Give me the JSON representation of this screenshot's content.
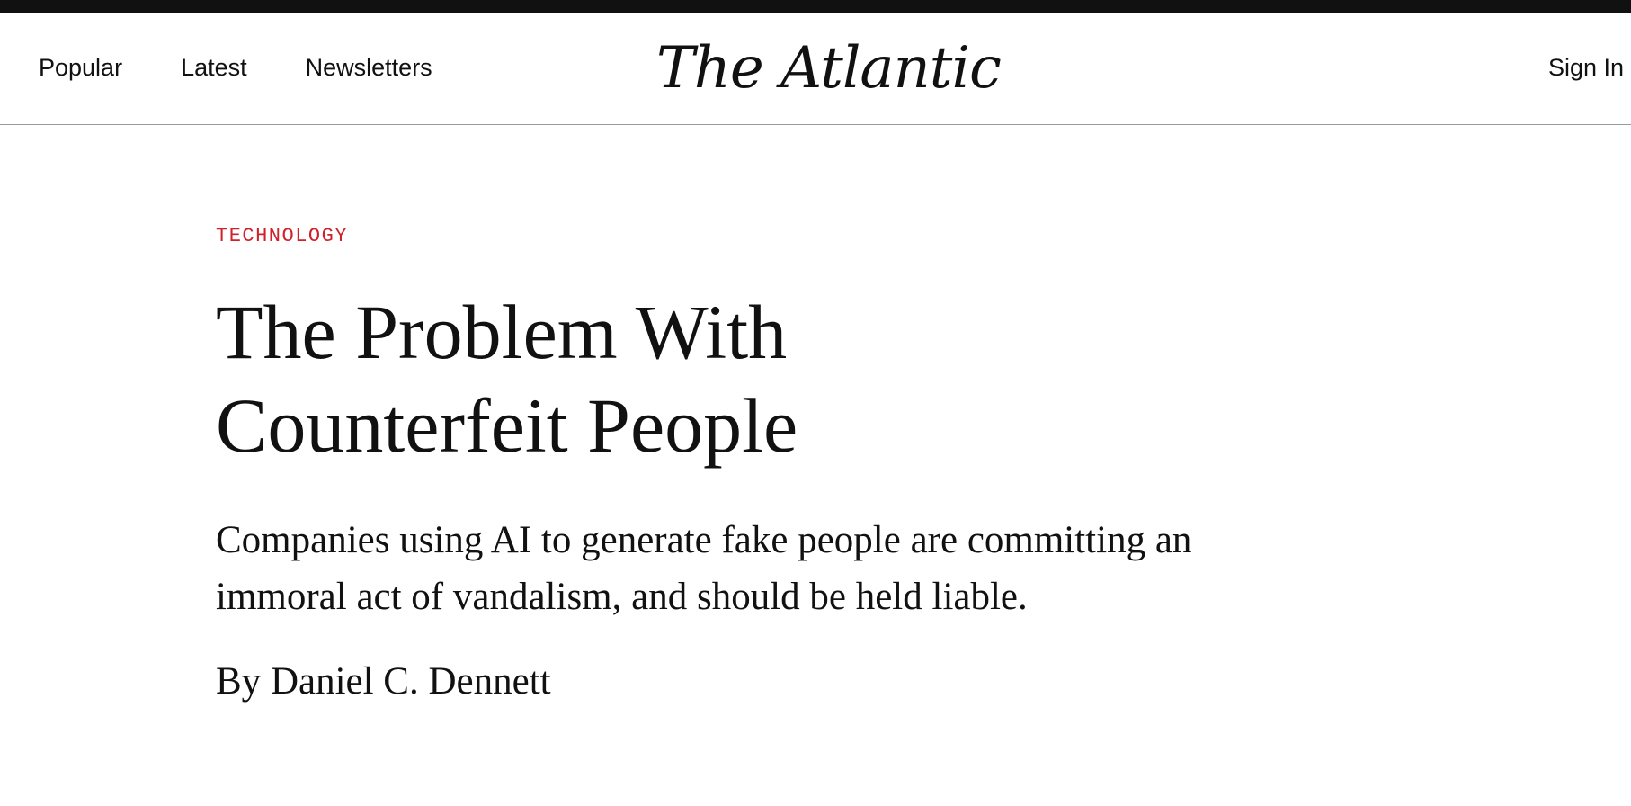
{
  "nav": {
    "links": [
      "Popular",
      "Latest",
      "Newsletters"
    ],
    "brand": "The Atlantic",
    "sign_in": "Sign In"
  },
  "article": {
    "section": "TECHNOLOGY",
    "headline_line1": "The Problem With",
    "headline_line2": "Counterfeit People",
    "dek": "Companies using AI to generate fake people are committing an immoral act of vandalism, and should be held liable.",
    "byline_prefix": "By",
    "author": "Daniel C. Dennett"
  },
  "colors": {
    "section_accent": "#d0202a",
    "top_bar": "#111111",
    "text": "#111111"
  }
}
